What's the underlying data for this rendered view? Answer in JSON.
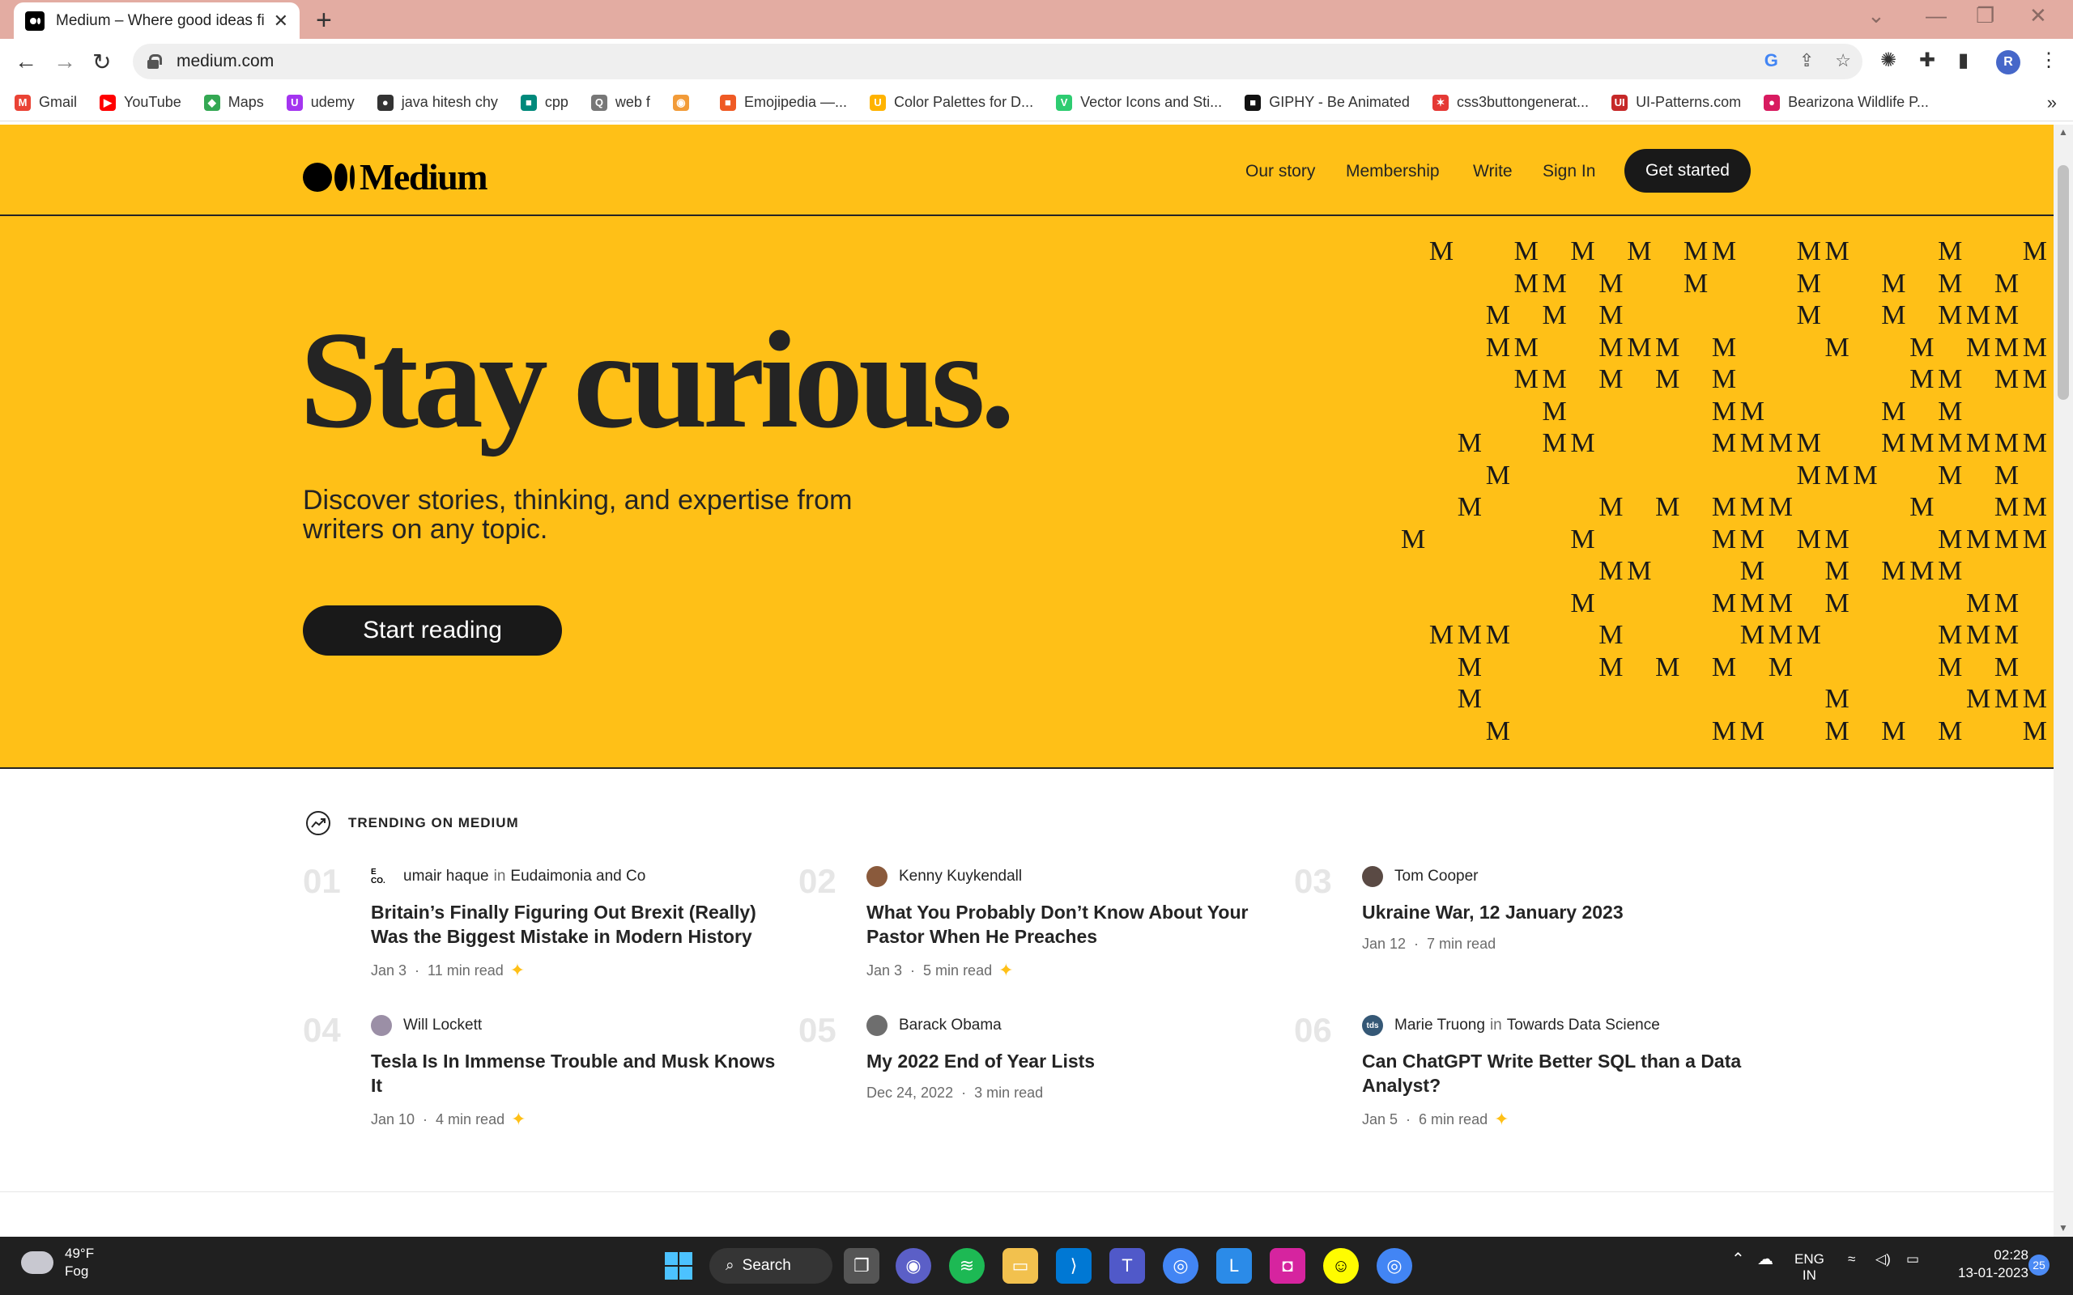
{
  "browser": {
    "tab_title": "Medium – Where good ideas find you",
    "url": "medium.com",
    "profile_initial": "R",
    "bookmarks": [
      {
        "label": "Gmail",
        "color": "#ea4335",
        "glyph": "M"
      },
      {
        "label": "YouTube",
        "color": "#ff0000",
        "glyph": "▶"
      },
      {
        "label": "Maps",
        "color": "#34a853",
        "glyph": "◆"
      },
      {
        "label": "udemy",
        "color": "#a435f0",
        "glyph": "U"
      },
      {
        "label": "java hitesh chy",
        "color": "#333333",
        "glyph": "●"
      },
      {
        "label": "cpp",
        "color": "#00897b",
        "glyph": "■"
      },
      {
        "label": "web f",
        "color": "#777777",
        "glyph": "Q"
      },
      {
        "label": "",
        "color": "#f29b38",
        "glyph": "◉"
      },
      {
        "label": "Emojipedia —...",
        "color": "#ef5a24",
        "glyph": "■"
      },
      {
        "label": "Color Palettes for D...",
        "color": "#ffb300",
        "glyph": "U"
      },
      {
        "label": "Vector Icons and Sti...",
        "color": "#2ecc71",
        "glyph": "V"
      },
      {
        "label": "GIPHY - Be Animated",
        "color": "#111111",
        "glyph": "■"
      },
      {
        "label": "css3buttongenerat...",
        "color": "#e53935",
        "glyph": "✶"
      },
      {
        "label": "UI-Patterns.com",
        "color": "#c62828",
        "glyph": "UI"
      },
      {
        "label": "Bearizona Wildlife P...",
        "color": "#d81b60",
        "glyph": "●"
      }
    ]
  },
  "header": {
    "logo_text": "Medium",
    "nav": [
      "Our story",
      "Membership",
      "Write",
      "Sign In"
    ],
    "cta": "Get started"
  },
  "hero": {
    "headline": "Stay curious.",
    "subline": "Discover stories, thinking, and expertise from writers on any topic.",
    "button": "Start reading",
    "pattern_glyph": "M"
  },
  "trending": {
    "heading": "TRENDING ON MEDIUM",
    "articles": [
      {
        "num": "01",
        "author": "umair haque",
        "in_label": "in",
        "publication": "Eudaimonia and Co",
        "avatar_color": "#ffffff",
        "avatar_text": "E CO.",
        "title": "Britain’s Finally Figuring Out Brexit (Really) Was the Biggest Mistake in Modern History",
        "date": "Jan 3",
        "read": "11 min read",
        "member": true
      },
      {
        "num": "02",
        "author": "Kenny Kuykendall",
        "in_label": "",
        "publication": "",
        "avatar_color": "#8a5a3c",
        "avatar_text": "",
        "title": "What You Probably Don’t Know About Your Pastor When He Preaches",
        "date": "Jan 3",
        "read": "5 min read",
        "member": true
      },
      {
        "num": "03",
        "author": "Tom Cooper",
        "in_label": "",
        "publication": "",
        "avatar_color": "#5a4a44",
        "avatar_text": "",
        "title": "Ukraine War, 12 January 2023",
        "date": "Jan 12",
        "read": "7 min read",
        "member": false
      },
      {
        "num": "04",
        "author": "Will Lockett",
        "in_label": "",
        "publication": "",
        "avatar_color": "#9b8fa6",
        "avatar_text": "",
        "title": "Tesla Is In Immense Trouble and Musk Knows It",
        "date": "Jan 10",
        "read": "4 min read",
        "member": true
      },
      {
        "num": "05",
        "author": "Barack Obama",
        "in_label": "",
        "publication": "",
        "avatar_color": "#6e6e6e",
        "avatar_text": "",
        "title": "My 2022 End of Year Lists",
        "date": "Dec 24, 2022",
        "read": "3 min read",
        "member": false
      },
      {
        "num": "06",
        "author": "Marie Truong",
        "in_label": "in",
        "publication": "Towards Data Science",
        "avatar_color": "#355876",
        "avatar_text": "tds",
        "title": "Can ChatGPT Write Better SQL than a Data Analyst?",
        "date": "Jan 5",
        "read": "6 min read",
        "member": true
      }
    ]
  },
  "taskbar": {
    "temperature": "49°F",
    "condition": "Fog",
    "search_label": "Search",
    "language_1": "ENG",
    "language_2": "IN",
    "time": "02:28",
    "date": "13-01-2023",
    "notifications": "25"
  }
}
